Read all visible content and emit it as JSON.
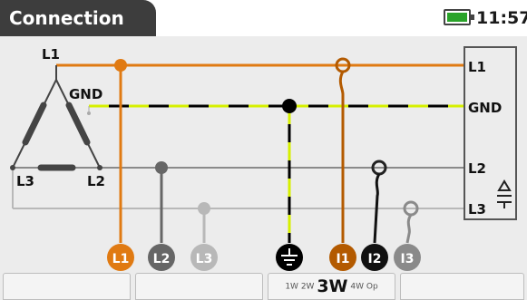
{
  "header": {
    "title": "Connection",
    "time": "11:57",
    "battery_icon": "battery-icon",
    "battery_color": "#29a329"
  },
  "diagram": {
    "lines": [
      "L1",
      "GND",
      "L2",
      "L3"
    ],
    "source_labels": {
      "l1": "L1",
      "gnd": "GND",
      "l2": "L2",
      "l3": "L3"
    },
    "voltage_terminals": [
      "L1",
      "L2",
      "L3"
    ],
    "current_clamps": [
      "I1",
      "I2",
      "I3"
    ],
    "earth_icon": "ground-icon",
    "colors": {
      "l1": "#e07a12",
      "l2": "#666666",
      "l3": "#b8b8b8",
      "gnd": "#000000",
      "gnd_stripe": "#d6f000",
      "i1": "#b35a00",
      "i2": "#111111",
      "i3": "#8a8a8a"
    }
  },
  "softkeys": {
    "mode_options": [
      "1W",
      "2W",
      "3W",
      "4W",
      "Op"
    ],
    "selected_mode": "3W"
  }
}
